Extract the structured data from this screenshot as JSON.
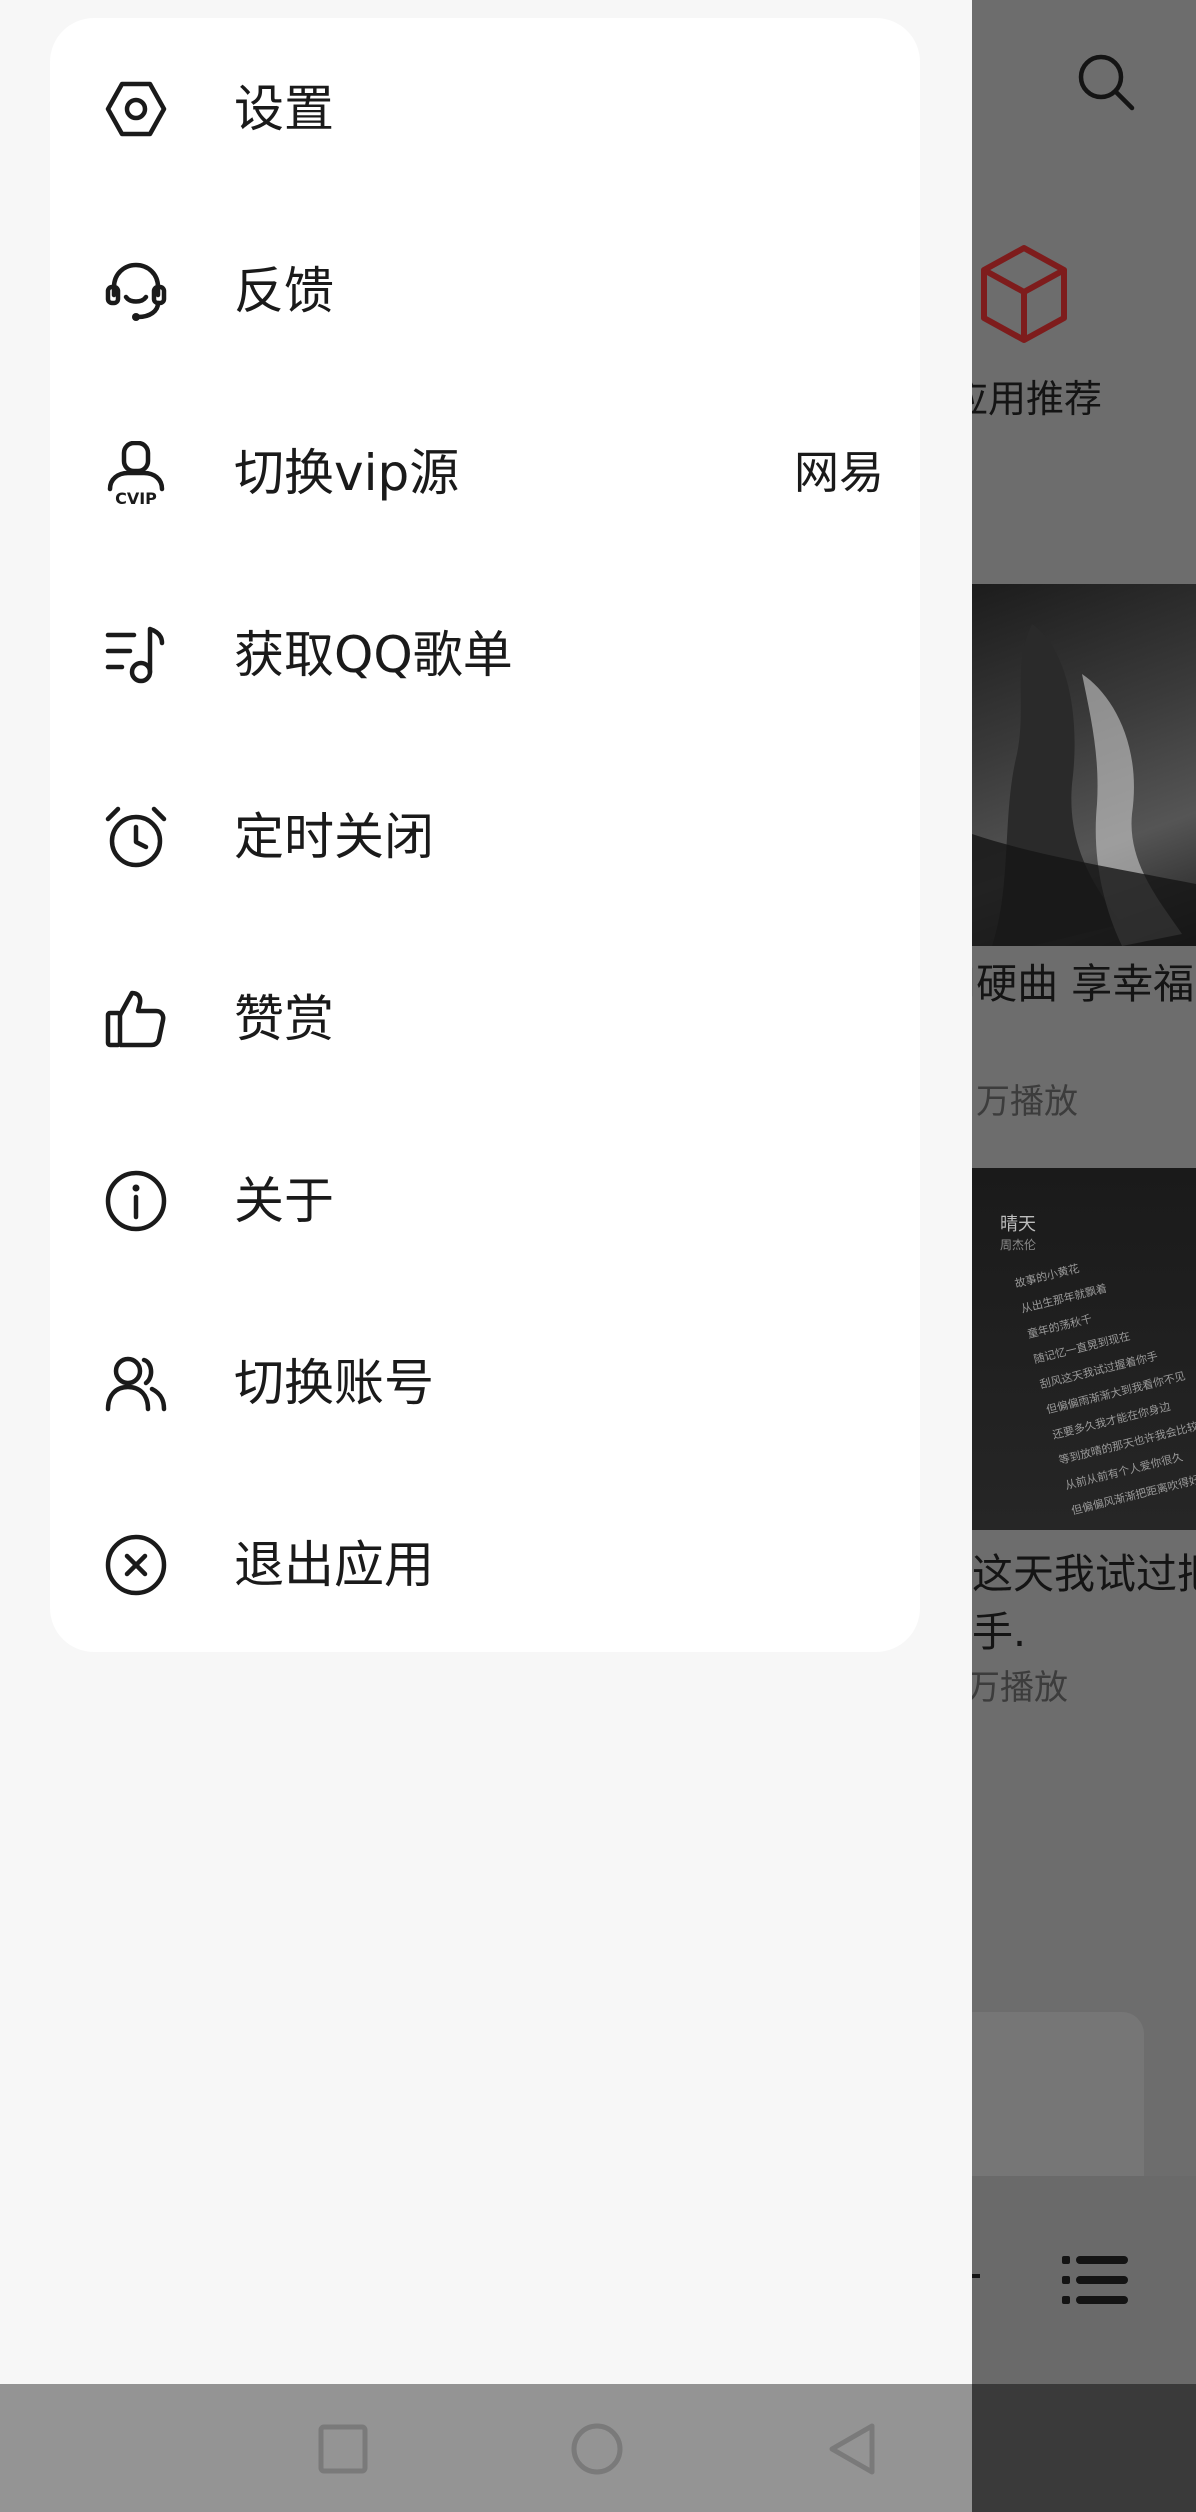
{
  "background": {
    "app_recommend_label": "应用推荐",
    "playlists": [
      {
        "title": "J硬曲 享幸福",
        "plays": "万播放"
      },
      {
        "title_line1": "这天我试过把",
        "title_line2": "手.",
        "plays": "万播放"
      }
    ],
    "cover2_lyrics": {
      "song": "晴天",
      "artist": "周杰伦",
      "lines": [
        "故事的小黄花",
        "从出生那年就飘着",
        "童年的荡秋千",
        "随记忆一直晃到现在",
        "刮风这天我试过握着你手",
        "但偏偏雨渐渐大到我看你不见",
        "还要多久我才能在你身边",
        "等到放晴的那天也许我会比较好一点",
        "从前从前有个人爱你很久",
        "但偏偏风渐渐把距离吹得好远"
      ]
    }
  },
  "drawer": {
    "menu": [
      {
        "icon": "settings-icon",
        "label": "设置"
      },
      {
        "icon": "headset-icon",
        "label": "反馈"
      },
      {
        "icon": "vip-user-icon",
        "label": "切换vip源",
        "value": "网易"
      },
      {
        "icon": "music-list-icon",
        "label": "获取QQ歌单"
      },
      {
        "icon": "alarm-clock-icon",
        "label": "定时关闭"
      },
      {
        "icon": "thumbs-up-icon",
        "label": "赞赏"
      },
      {
        "icon": "info-icon",
        "label": "关于"
      },
      {
        "icon": "users-icon",
        "label": "切换账号"
      },
      {
        "icon": "close-circle-icon",
        "label": "退出应用"
      }
    ]
  },
  "navbar": {
    "buttons": [
      "recent-apps-icon",
      "home-icon",
      "back-icon"
    ]
  },
  "colors": {
    "accent_red": "#8b1a1a",
    "drawer_bg": "#f7f7f7",
    "card_bg": "#ffffff"
  }
}
